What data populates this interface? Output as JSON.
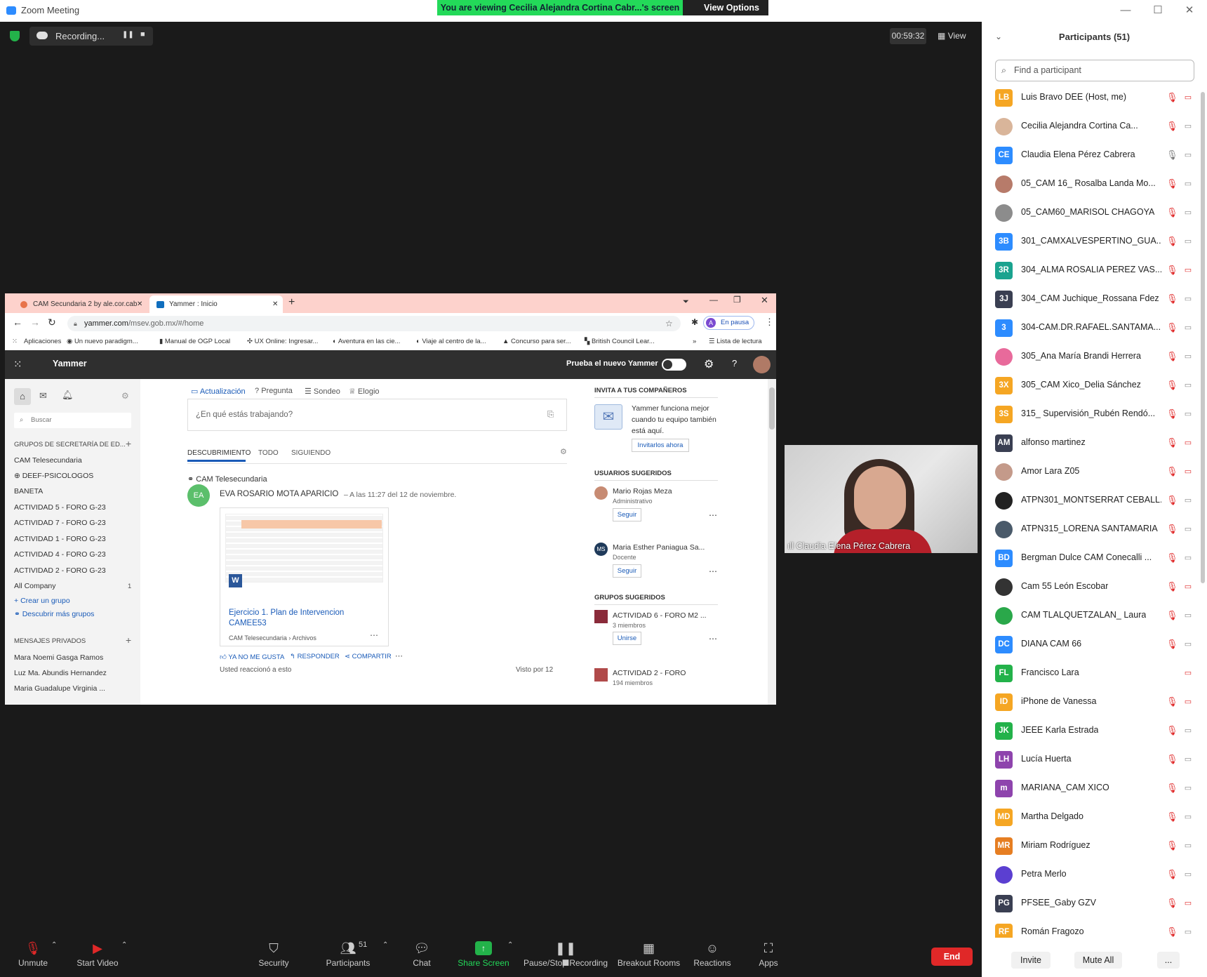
{
  "window": {
    "title": "Zoom Meeting",
    "minimize": "—",
    "maximize": "☐",
    "close": "✕"
  },
  "banner": {
    "text": "You are viewing Cecilia Alejandra Cortina Cabr...'s screen",
    "view_options": "View Options"
  },
  "recording": {
    "label": "Recording...",
    "pause": "❚❚",
    "stop": "■"
  },
  "timer": "00:59:32",
  "view": "View",
  "browser": {
    "tabs": [
      "CAM Secundaria 2 by ale.cor.cab",
      "Yammer : Inicio"
    ],
    "url_host": "yammer.com",
    "url_path": "/msev.gob.mx/#/home",
    "profile_status": "En pausa",
    "profile_initial": "A",
    "bookmarks": [
      "Aplicaciones",
      "Un nuevo paradigm...",
      "Manual de OGP Local",
      "UX Online: Ingresar...",
      "Aventura en las cie...",
      "Viaje al centro de la...",
      "Concurso para ser...",
      "British Council Lear...",
      "Lista de lectura"
    ],
    "more_bookmarks": "»"
  },
  "yammer": {
    "brand": "Yammer",
    "try_new": "Prueba el nuevo Yammer",
    "search_placeholder": "Buscar",
    "groups_header": "GRUPOS DE SECRETARÍA DE ED...",
    "groups": [
      "CAM Telesecundaria",
      "DEEF-PSICOLOGOS",
      "BANETA",
      "ACTIVIDAD 5 - FORO G-23",
      "ACTIVIDAD 7 - FORO G-23",
      "ACTIVIDAD 1 - FORO G-23",
      "ACTIVIDAD 4 - FORO G-23",
      "ACTIVIDAD 2 - FORO G-23",
      "All Company"
    ],
    "all_company_count": "1",
    "create_group": "Crear un grupo",
    "discover_groups": "Descubrir más grupos",
    "pm_header": "MENSAJES PRIVADOS",
    "pms": [
      "Mara Noemi Gasga Ramos",
      "Luz Ma. Abundis Hernandez",
      "Maria Guadalupe Virginia ..."
    ],
    "post_types": [
      "Actualización",
      "Pregunta",
      "Sondeo",
      "Elogio"
    ],
    "composer_placeholder": "¿En qué estás trabajando?",
    "feed_tabs": [
      "DESCUBRIMIENTO",
      "TODO",
      "SIGUIENDO"
    ],
    "post_group": "CAM Telesecundaria",
    "post_author_initials": "EA",
    "post_author": "EVA ROSARIO MOTA APARICIO",
    "post_time": "– A las 11:27 del 12 de noviembre.",
    "doc_title": "Ejercicio 1. Plan de Intervencion CAMEE53",
    "doc_path": "CAM Telesecundaria › Archivos",
    "doc_badge": "W",
    "actions": [
      "YA NO ME GUSTA",
      "RESPONDER",
      "COMPARTIR"
    ],
    "reacted": "Usted reaccionó a esto",
    "seen": "Visto por 12",
    "invite_header": "INVITA A TUS COMPAÑEROS",
    "invite_text": "Yammer funciona mejor cuando tu equipo también está aquí.",
    "invite_button": "Invitarlos ahora",
    "suggested_users_header": "USUARIOS SUGERIDOS",
    "suggested_users": [
      {
        "name": "Mario Rojas Meza",
        "role": "Administrativo",
        "initials": ""
      },
      {
        "name": "Maria Esther Paniagua Sa...",
        "role": "Docente",
        "initials": "MS"
      }
    ],
    "follow": "Seguir",
    "suggested_groups_header": "GRUPOS SUGERIDOS",
    "suggested_groups": [
      {
        "name": "ACTIVIDAD 6 - FORO M2 ...",
        "members": "3 miembros"
      },
      {
        "name": "ACTIVIDAD 2 - FORO",
        "members": "194 miembros"
      }
    ],
    "join": "Unirse"
  },
  "video": {
    "name": "Claudia Elena Pérez Cabrera"
  },
  "participants": {
    "title": "Participants (51)",
    "search_placeholder": "Find a participant",
    "list": [
      {
        "initials": "LB",
        "color": "#f5a623",
        "name": "Luis Bravo DEE (Host, me)",
        "mic": "muted",
        "cam": "off"
      },
      {
        "initials": "",
        "color": "#d9b59a",
        "name": "Cecilia Alejandra Cortina Ca...",
        "mic": "muted",
        "cam": "on"
      },
      {
        "initials": "CE",
        "color": "#2d8cff",
        "name": "Claudia Elena Pérez Cabrera",
        "mic": "on",
        "cam": "on"
      },
      {
        "initials": "",
        "color": "#b77b6a",
        "name": "05_CAM 16_ Rosalba Landa Mo...",
        "mic": "muted",
        "cam": "on"
      },
      {
        "initials": "",
        "color": "#8c8c8c",
        "name": "05_CAM60_MARISOL CHAGOYA",
        "mic": "muted",
        "cam": "on"
      },
      {
        "initials": "3B",
        "color": "#2d8cff",
        "name": "301_CAMXALVESPERTINO_GUA...",
        "mic": "muted",
        "cam": "on"
      },
      {
        "initials": "3R",
        "color": "#1aa38f",
        "name": "304_ALMA ROSALIA PEREZ VAS...",
        "mic": "muted",
        "cam": "off"
      },
      {
        "initials": "3J",
        "color": "#3a3f52",
        "name": "304_CAM Juchique_Rossana Fdez",
        "mic": "muted",
        "cam": "on"
      },
      {
        "initials": "3",
        "color": "#2d8cff",
        "name": "304-CAM.DR.RAFAEL.SANTAMA...",
        "mic": "muted",
        "cam": "on"
      },
      {
        "initials": "",
        "color": "#e86a9b",
        "name": "305_Ana María Brandi Herrera",
        "mic": "muted",
        "cam": "on"
      },
      {
        "initials": "3X",
        "color": "#f5a623",
        "name": "305_CAM Xico_Delia Sánchez",
        "mic": "muted",
        "cam": "on"
      },
      {
        "initials": "3S",
        "color": "#f5a623",
        "name": "315_ Supervisión_Rubén Rendó...",
        "mic": "muted",
        "cam": "on"
      },
      {
        "initials": "AM",
        "color": "#3a3f52",
        "name": "alfonso martinez",
        "mic": "muted",
        "cam": "off"
      },
      {
        "initials": "",
        "color": "#c49a8a",
        "name": "Amor Lara Z05",
        "mic": "muted",
        "cam": "off"
      },
      {
        "initials": "",
        "color": "#222222",
        "name": "ATPN301_MONTSERRAT CEBALL...",
        "mic": "muted",
        "cam": "on"
      },
      {
        "initials": "",
        "color": "#4a5a6a",
        "name": "ATPN315_LORENA SANTAMARIA",
        "mic": "muted",
        "cam": "on"
      },
      {
        "initials": "BD",
        "color": "#2d8cff",
        "name": "Bergman Dulce CAM Conecalli ...",
        "mic": "muted",
        "cam": "on"
      },
      {
        "initials": "",
        "color": "#333333",
        "name": "Cam 55 León Escobar",
        "mic": "muted",
        "cam": "off"
      },
      {
        "initials": "",
        "color": "#2aa84a",
        "name": "CAM TLALQUETZALAN_ Laura",
        "mic": "muted",
        "cam": "on"
      },
      {
        "initials": "DC",
        "color": "#2d8cff",
        "name": "DIANA CAM 66",
        "mic": "muted",
        "cam": "on"
      },
      {
        "initials": "FL",
        "color": "#23b24a",
        "name": "Francisco Lara",
        "mic": "none",
        "cam": "off"
      },
      {
        "initials": "ID",
        "color": "#f5a623",
        "name": "iPhone de Vanessa",
        "mic": "muted",
        "cam": "off"
      },
      {
        "initials": "JK",
        "color": "#23b24a",
        "name": "JEEE Karla Estrada",
        "mic": "muted",
        "cam": "on"
      },
      {
        "initials": "LH",
        "color": "#8e44ad",
        "name": "Lucía Huerta",
        "mic": "muted",
        "cam": "on"
      },
      {
        "initials": "m",
        "color": "#8e44ad",
        "name": "MARIANA_CAM XICO",
        "mic": "muted",
        "cam": "on"
      },
      {
        "initials": "MD",
        "color": "#f5a623",
        "name": "Martha Delgado",
        "mic": "muted",
        "cam": "on"
      },
      {
        "initials": "MR",
        "color": "#e67e22",
        "name": "Miriam Rodríguez",
        "mic": "muted",
        "cam": "on"
      },
      {
        "initials": "",
        "color": "#5b3fd1",
        "name": "Petra Merlo",
        "mic": "muted",
        "cam": "on"
      },
      {
        "initials": "PG",
        "color": "#3a3f52",
        "name": "PFSEE_Gaby GZV",
        "mic": "muted",
        "cam": "off"
      },
      {
        "initials": "RF",
        "color": "#f5a623",
        "name": "Román Fragozo",
        "mic": "muted",
        "cam": "on"
      }
    ],
    "invite": "Invite",
    "mute_all": "Mute All",
    "more": "..."
  },
  "toolbar": {
    "unmute": "Unmute",
    "start_video": "Start Video",
    "security": "Security",
    "participants": "Participants",
    "participants_count": "51",
    "chat": "Chat",
    "share_screen": "Share Screen",
    "pause_stop": "Pause/Stop Recording",
    "breakout": "Breakout Rooms",
    "reactions": "Reactions",
    "apps": "Apps",
    "end": "End"
  }
}
